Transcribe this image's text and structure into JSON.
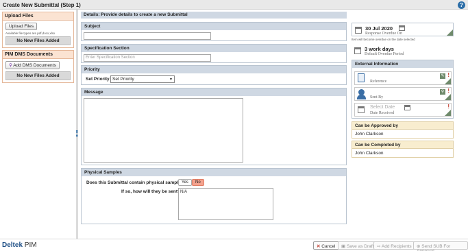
{
  "window": {
    "title": "Create New Submittal (Step 1)",
    "help_icon": "?"
  },
  "left": {
    "upload": {
      "header": "Upload Files",
      "button": "Upload Files",
      "filetypes": "Available file types are pdf,docx,xlsx",
      "status": "No New Files Added"
    },
    "pim_dms": {
      "header": "PIM DMS Documents",
      "button": "Add DMS Documents",
      "status": "No New Files Added"
    }
  },
  "details": {
    "header": "Details: Provide details to create a new Submittal",
    "subject": {
      "label": "Subject",
      "value": ""
    },
    "spec": {
      "label": "Specification Section",
      "placeholder": "Enter Specification Section"
    },
    "priority": {
      "label": "Priority",
      "field_label": "Set Priority",
      "selected": "Set Priority"
    },
    "message": {
      "label": "Message",
      "value": ""
    },
    "samples": {
      "label": "Physical Samples",
      "question": "Does this Submittal contain physical samples?",
      "yes": "Yes",
      "no": "No",
      "how_label": "If so, how will they be sent?",
      "how_value": "N/A"
    }
  },
  "right": {
    "due": {
      "date": "30 Jul 2020",
      "label": "Response Overdue On",
      "note": "Item will become overdue on the date selected"
    },
    "period": {
      "value": "3 work days",
      "label": "Default Overdue Period"
    },
    "external": {
      "header": "External Information",
      "reference": "Reference",
      "sent_by": "Sent By",
      "date_received_placeholder": "Select Date",
      "date_received": "Date Received"
    },
    "approved_by": {
      "header": "Can be Approved by",
      "name": "John Clarkson"
    },
    "completed_by": {
      "header": "Can be Completed by",
      "name": "John Clarkson"
    }
  },
  "footer": {
    "logo_a": "Deltek",
    "logo_b": "PIM",
    "cancel": "Cancel",
    "save_draft": "Save as Draft",
    "add_recipients": "Add Recipients",
    "send": "Send SUB For Approval"
  }
}
